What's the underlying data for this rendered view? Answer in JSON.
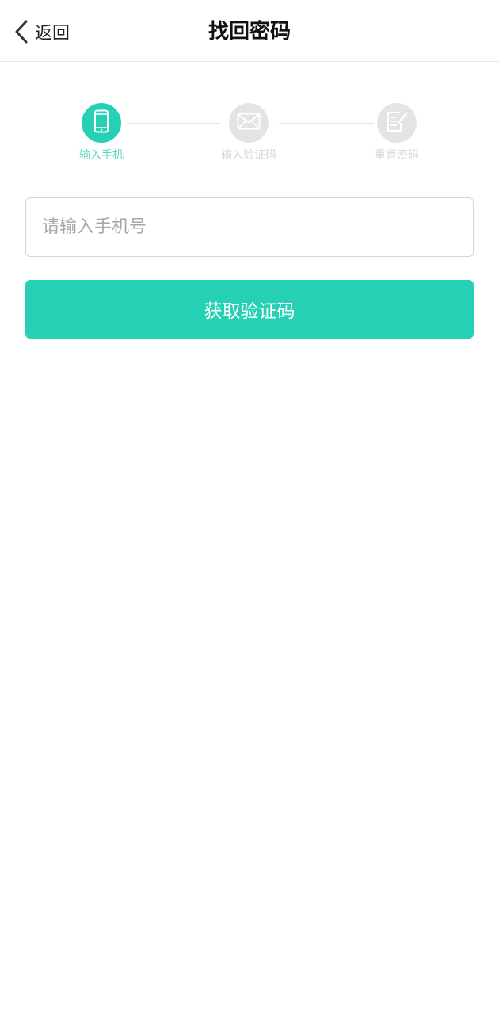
{
  "header": {
    "back_label": "返回",
    "title": "找回密码"
  },
  "steps": [
    {
      "label": "输入手机",
      "icon": "phone-icon",
      "active": true
    },
    {
      "label": "输入验证码",
      "icon": "mail-icon",
      "active": false
    },
    {
      "label": "重置密码",
      "icon": "edit-document-icon",
      "active": false
    }
  ],
  "form": {
    "phone_placeholder": "请输入手机号",
    "phone_value": "",
    "submit_label": "获取验证码"
  },
  "colors": {
    "accent": "#26d0b4",
    "inactive": "#e4e4e4"
  }
}
